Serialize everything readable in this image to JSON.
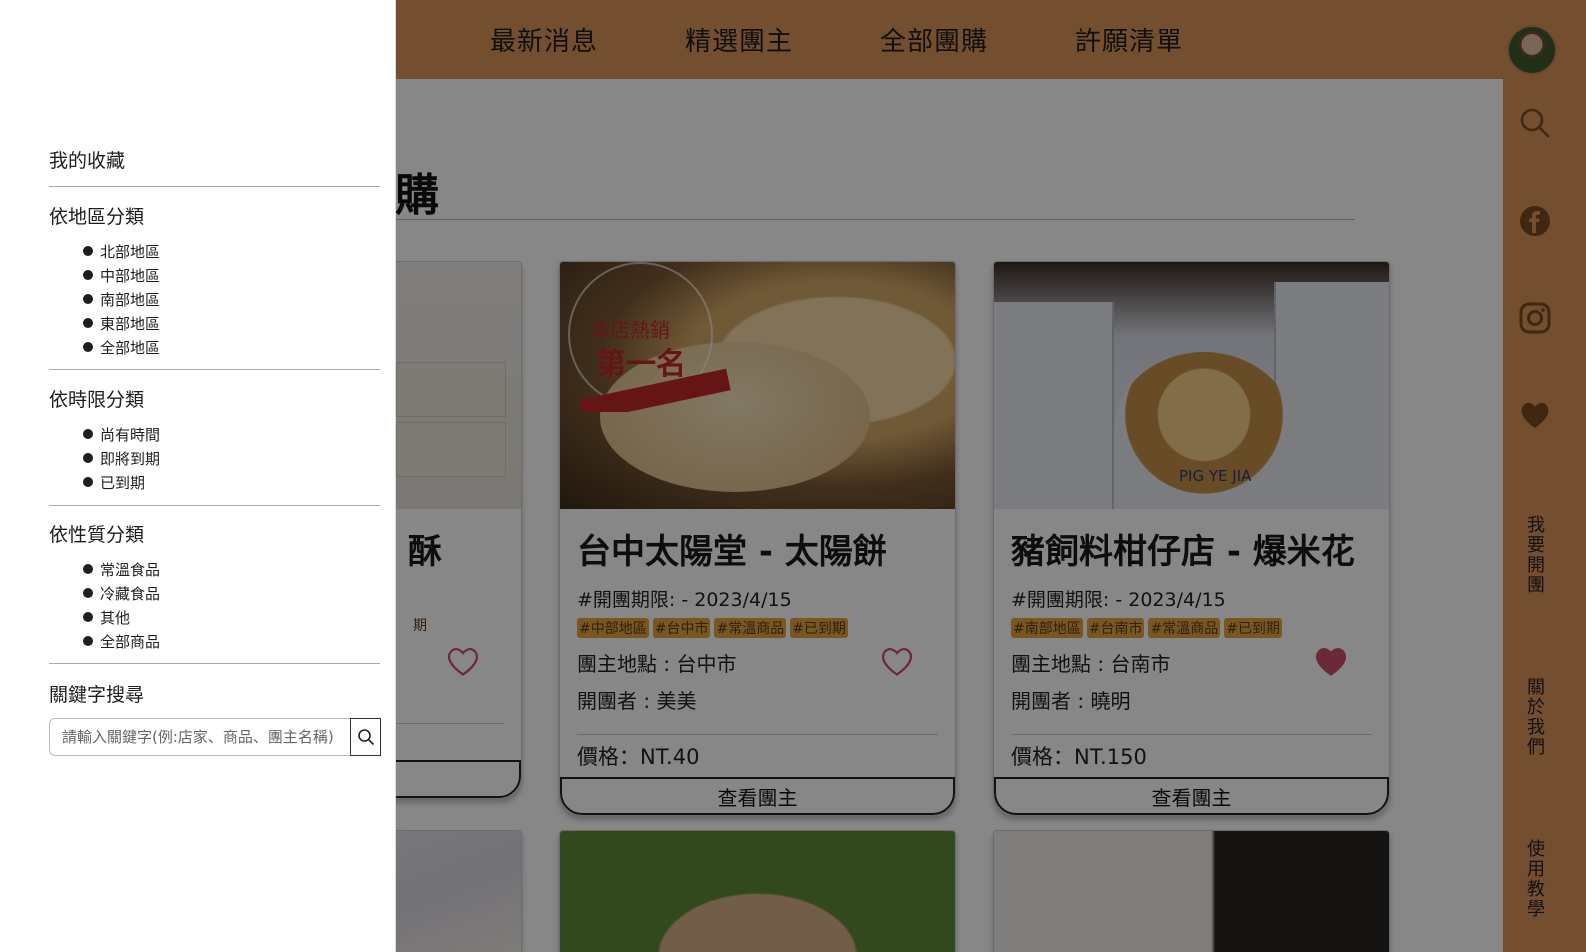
{
  "nav": {
    "items": [
      "最新消息",
      "精選團主",
      "全部團購",
      "許願清單"
    ]
  },
  "rail": {
    "links": [
      "我要開團",
      "關於我們",
      "使用教學"
    ]
  },
  "main": {
    "section_title": "購",
    "cards": [
      {
        "title": "酥",
        "tag_fragment": "期",
        "favorited": false
      },
      {
        "title": "台中太陽堂 - 太陽餅",
        "date": "#開團期限: - 2023/4/15",
        "tags": [
          "#中部地區",
          "#台中市",
          "#常溫商品",
          "#已到期"
        ],
        "location": "團主地點 : 台中市",
        "owner": "開團者 : 美美",
        "price": "價格：NT.40",
        "button": "查看團主",
        "favorited": false
      },
      {
        "title": "豬飼料柑仔店 - 爆米花",
        "date": "#開團期限: - 2023/4/15",
        "tags": [
          "#南部地區",
          "#台南市",
          "#常溫商品",
          "#已到期"
        ],
        "location": "團主地點 : 台南市",
        "owner": "開團者 : 曉明",
        "price": "價格：NT.150",
        "button": "查看團主",
        "favorited": true
      }
    ]
  },
  "sidebar": {
    "favorites": "我的收藏",
    "region": {
      "heading": "依地區分類",
      "items": [
        "北部地區",
        "中部地區",
        "南部地區",
        "東部地區",
        "全部地區"
      ]
    },
    "time": {
      "heading": "依時限分類",
      "items": [
        "尚有時間",
        "即將到期",
        "已到期"
      ]
    },
    "type": {
      "heading": "依性質分類",
      "items": [
        "常溫食品",
        "冷藏食品",
        "其他",
        "全部商品"
      ]
    },
    "keyword": {
      "heading": "關鍵字搜尋",
      "placeholder": "請輸入關鍵字(例:店家、商品、團主名稱)"
    }
  },
  "colors": {
    "brand": "#d9935a",
    "tag_bg": "#e5a43f",
    "heart": "#c9506a"
  }
}
